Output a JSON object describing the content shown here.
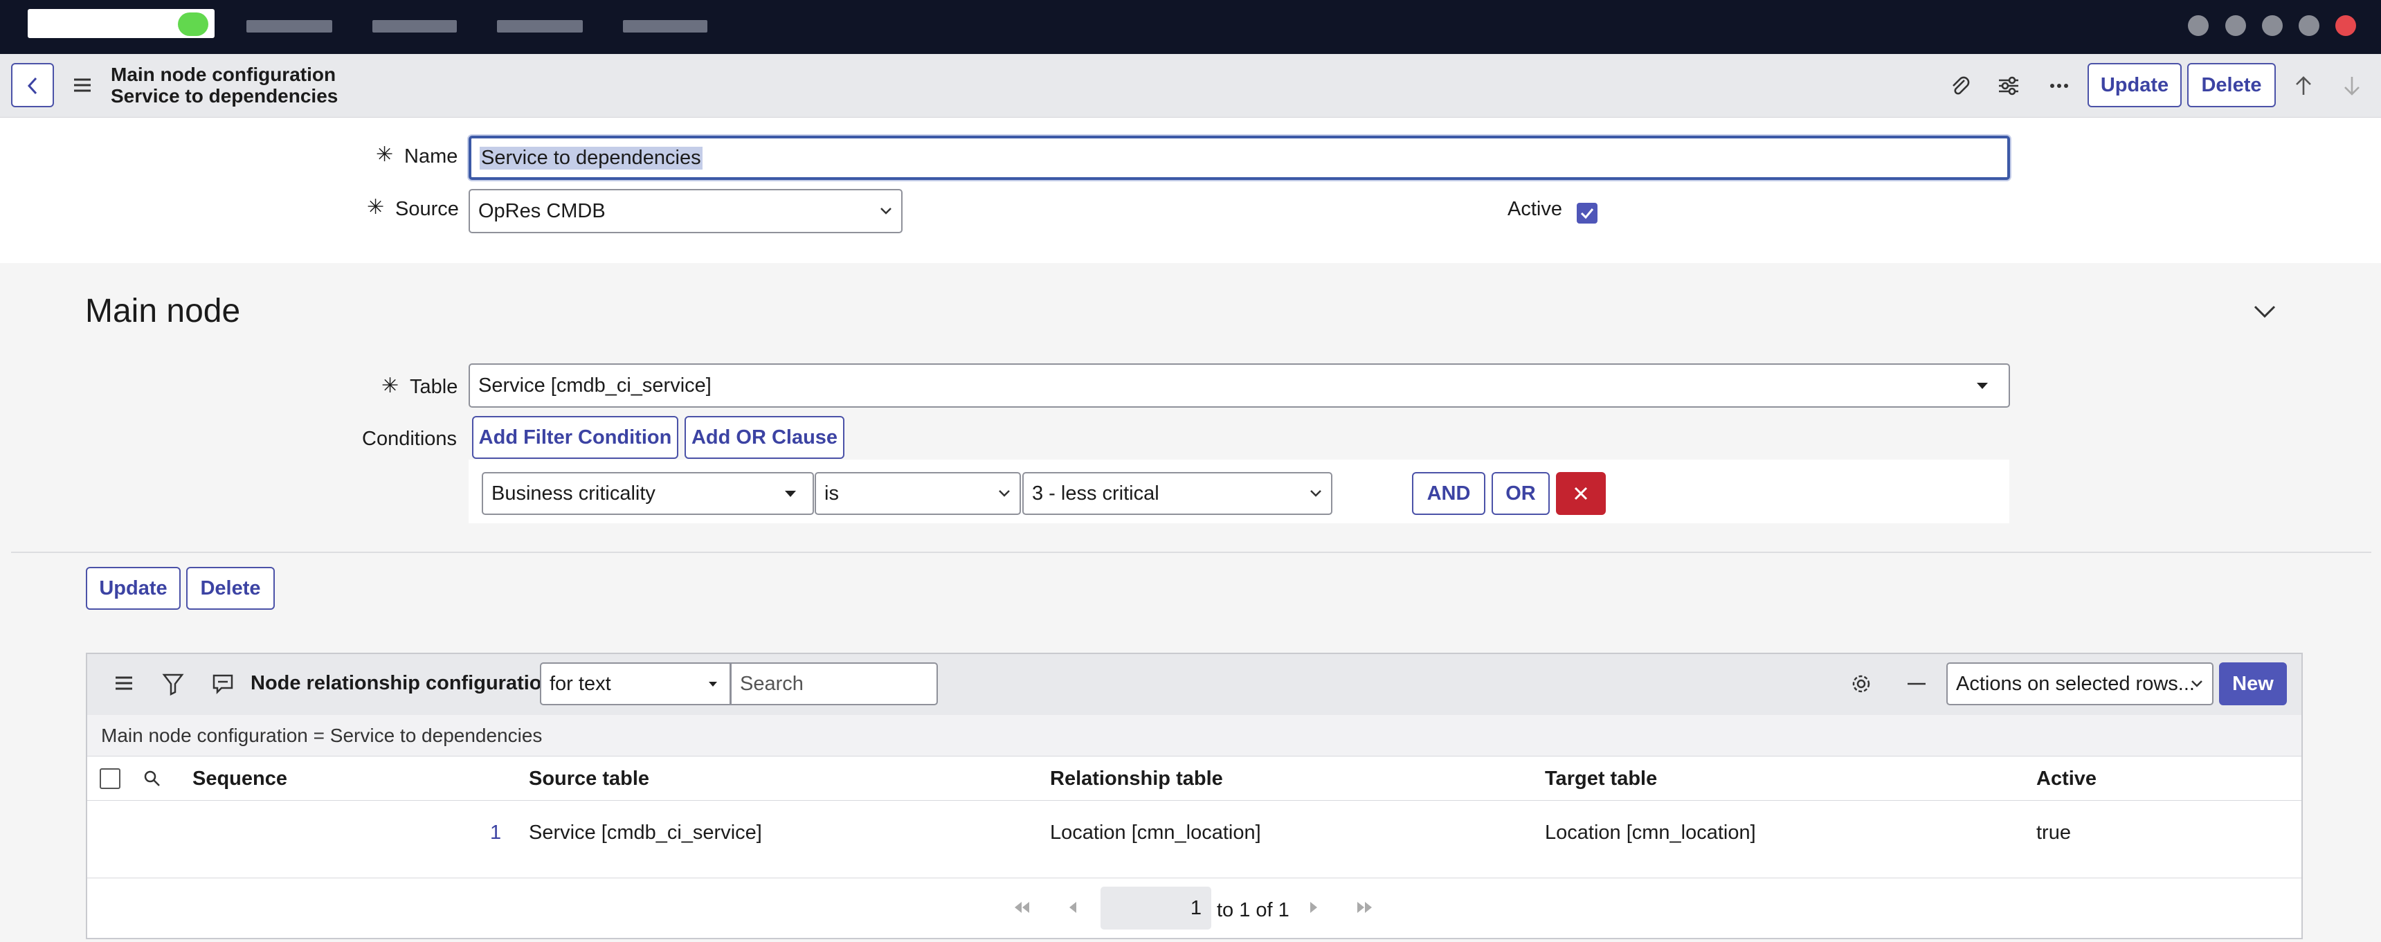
{
  "header": {
    "title_line1": "Main node configuration",
    "title_line2": "Service to dependencies",
    "update_label": "Update",
    "delete_label": "Delete"
  },
  "form": {
    "name_label": "Name",
    "name_value": "Service to dependencies",
    "source_label": "Source",
    "source_value": "OpRes CMDB",
    "active_label": "Active",
    "active_checked": true
  },
  "main_node": {
    "section_title": "Main node",
    "table_label": "Table",
    "table_value": "Service [cmdb_ci_service]",
    "conditions_label": "Conditions",
    "add_filter_label": "Add Filter Condition",
    "add_or_label": "Add OR Clause",
    "condition": {
      "field": "Business criticality",
      "operator": "is",
      "value": "3 - less critical",
      "and_label": "AND",
      "or_label": "OR"
    }
  },
  "form_buttons": {
    "update_label": "Update",
    "delete_label": "Delete"
  },
  "related_list": {
    "title": "Node relationship configurations",
    "search_field": "for text",
    "search_placeholder": "Search",
    "actions_label": "Actions on selected rows...",
    "new_label": "New",
    "breadcrumb": "Main node configuration = Service to dependencies",
    "columns": [
      "Sequence",
      "Source table",
      "Relationship table",
      "Target table",
      "Active"
    ],
    "rows": [
      {
        "sequence": "1",
        "source_table": "Service [cmdb_ci_service]",
        "relationship_table": "Location [cmn_location]",
        "target_table": "Location [cmn_location]",
        "active": "true"
      }
    ],
    "pager": {
      "current": "1",
      "range_text": "to 1 of 1"
    }
  },
  "colors": {
    "accent": "#4f56b8",
    "danger": "#c4232f",
    "topbar": "#0f1426"
  }
}
